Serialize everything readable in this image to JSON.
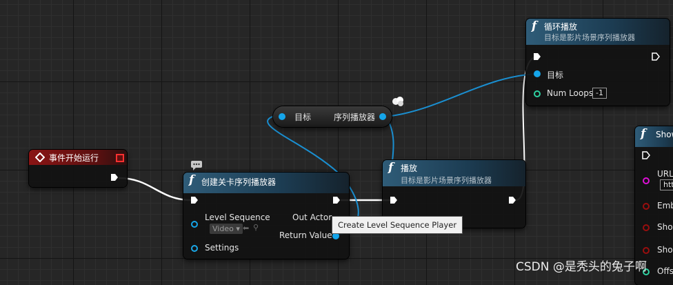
{
  "nodes": {
    "event": {
      "title": "事件开始运行"
    },
    "create": {
      "title": "创建关卡序列播放器",
      "pin_level_sequence": "Level Sequence",
      "level_sequence_value": "Video",
      "pin_settings": "Settings",
      "pin_out_actor": "Out Actor",
      "pin_return_value": "Return Value"
    },
    "reroute": {
      "pin_target": "目标",
      "pin_player": "序列播放器"
    },
    "play": {
      "title": "播放",
      "subtitle": "目标是影片场景序列播放器"
    },
    "loop": {
      "title": "循环播放",
      "subtitle": "目标是影片场景序列播放器",
      "pin_target": "目标",
      "pin_num_loops": "Num Loops",
      "num_loops_value": "-1"
    },
    "show": {
      "title": "Show",
      "pin_url": "URL",
      "url_value": "htt",
      "pin_emb": "Emb",
      "pin_show1": "Show",
      "pin_show2": "Show",
      "pin_offs": "Offs"
    }
  },
  "tooltip": "Create Level Sequence Player",
  "watermark": "CSDN @是秃头的兔子啊",
  "colors": {
    "exec_wire": "#ffffff",
    "object_wire": "#1a8fd1",
    "function_header": "#2f5c78",
    "event_header": "#8a1414"
  },
  "icons": {
    "function": "f",
    "event": "diamond-event-icon",
    "comment": "speech-bubble-icon"
  }
}
